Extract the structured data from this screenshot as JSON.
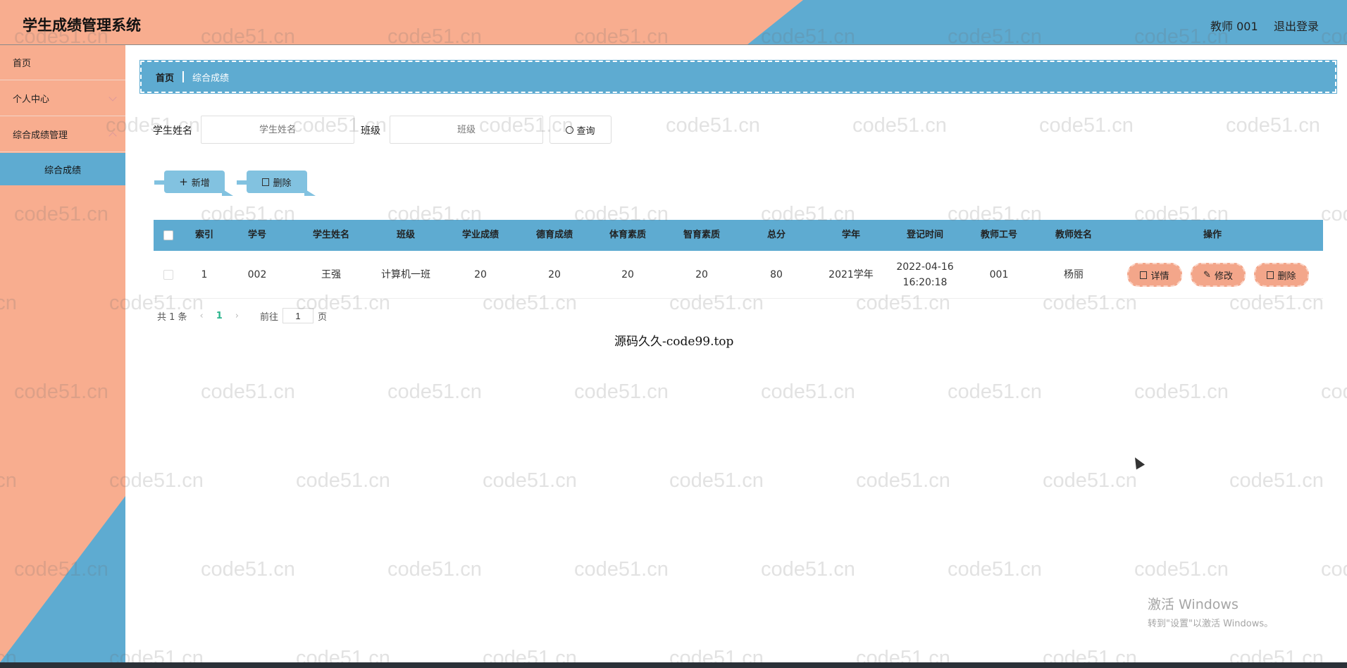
{
  "app_title": "学生成绩管理系统",
  "header": {
    "user": "教师 001",
    "logout": "退出登录"
  },
  "sidebar": {
    "items": [
      {
        "label": "首页"
      },
      {
        "label": "个人中心"
      },
      {
        "label": "综合成绩管理"
      },
      {
        "label": "综合成绩"
      }
    ]
  },
  "breadcrumb": {
    "home": "首页",
    "current": "综合成绩"
  },
  "search": {
    "name_label": "学生姓名",
    "name_placeholder": "学生姓名",
    "class_label": "班级",
    "class_placeholder": "班级",
    "button": "查询"
  },
  "toolbar": {
    "add": "新增",
    "delete": "删除"
  },
  "table": {
    "headers": [
      "索引",
      "学号",
      "学生姓名",
      "班级",
      "学业成绩",
      "德育成绩",
      "体育素质",
      "智育素质",
      "总分",
      "学年",
      "登记时间",
      "教师工号",
      "教师姓名",
      "操作"
    ],
    "rows": [
      {
        "index": "1",
        "student_id": "002",
        "student_name": "王强",
        "class": "计算机一班",
        "academic": "20",
        "moral": "20",
        "physical": "20",
        "intellectual": "20",
        "total": "80",
        "year": "2021学年",
        "date": "2022-04-16",
        "time": "16:20:18",
        "teacher_id": "001",
        "teacher_name": "杨丽"
      }
    ],
    "actions": {
      "detail": "详情",
      "edit": "修改",
      "delete": "删除"
    }
  },
  "pager": {
    "total": "共 1 条",
    "page": "1",
    "goto_prefix": "前往",
    "goto_value": "1",
    "goto_suffix": "页"
  },
  "footer": "源码久久-code99.top",
  "watermark": "code51.cn",
  "activation": {
    "title": "激活 Windows",
    "subtitle": "转到\"设置\"以激活 Windows。"
  },
  "colors": {
    "salmon": "#f8ad8f",
    "blue": "#5eabd1",
    "light_blue": "#82c2e0",
    "action": "#f3a68a",
    "pager_active": "#2ab48c"
  }
}
